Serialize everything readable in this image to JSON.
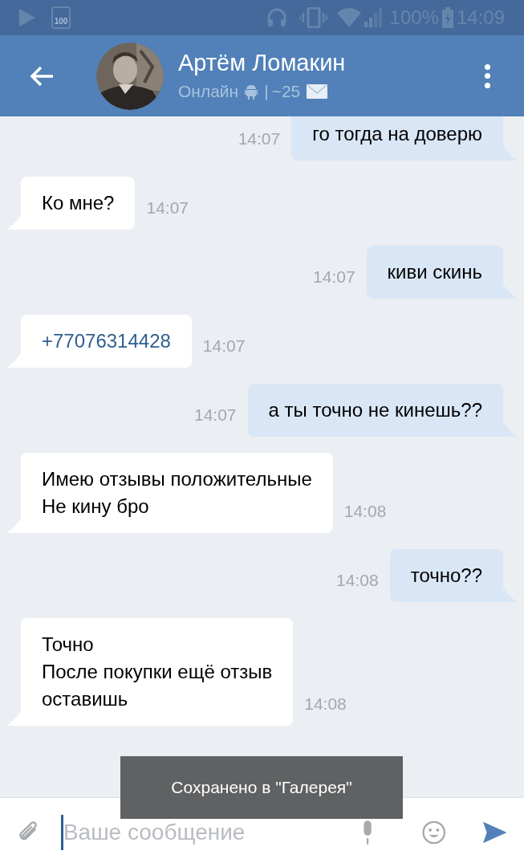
{
  "status_bar": {
    "battery_text": "100%",
    "time": "14:09",
    "badge": "100"
  },
  "header": {
    "name": "Артём Ломакин",
    "status": "Онлайн",
    "separator": "|",
    "count": "~25"
  },
  "messages": [
    {
      "outgoing": true,
      "kind": "text",
      "lines": [
        "го тогда на доверю"
      ],
      "time": "14:07"
    },
    {
      "outgoing": false,
      "kind": "text",
      "lines": [
        "Ко мне?"
      ],
      "time": "14:07"
    },
    {
      "outgoing": true,
      "kind": "text",
      "lines": [
        "киви скинь"
      ],
      "time": "14:07"
    },
    {
      "outgoing": false,
      "kind": "link",
      "lines": [
        "+77076314428"
      ],
      "time": "14:07"
    },
    {
      "outgoing": true,
      "kind": "text",
      "lines": [
        "а ты точно не кинешь??"
      ],
      "time": "14:07"
    },
    {
      "outgoing": false,
      "kind": "text",
      "lines": [
        "Имею отзывы положительные",
        "Не кину бро"
      ],
      "time": "14:08"
    },
    {
      "outgoing": true,
      "kind": "text",
      "lines": [
        "точно??"
      ],
      "time": "14:08"
    },
    {
      "outgoing": false,
      "kind": "text",
      "lines": [
        "Точно",
        "После покупки ещё отзыв",
        "оставишь"
      ],
      "time": "14:08"
    }
  ],
  "composer": {
    "placeholder": "Ваше сообщение"
  },
  "toast": {
    "text": "Сохранено в \"Галерея\""
  }
}
